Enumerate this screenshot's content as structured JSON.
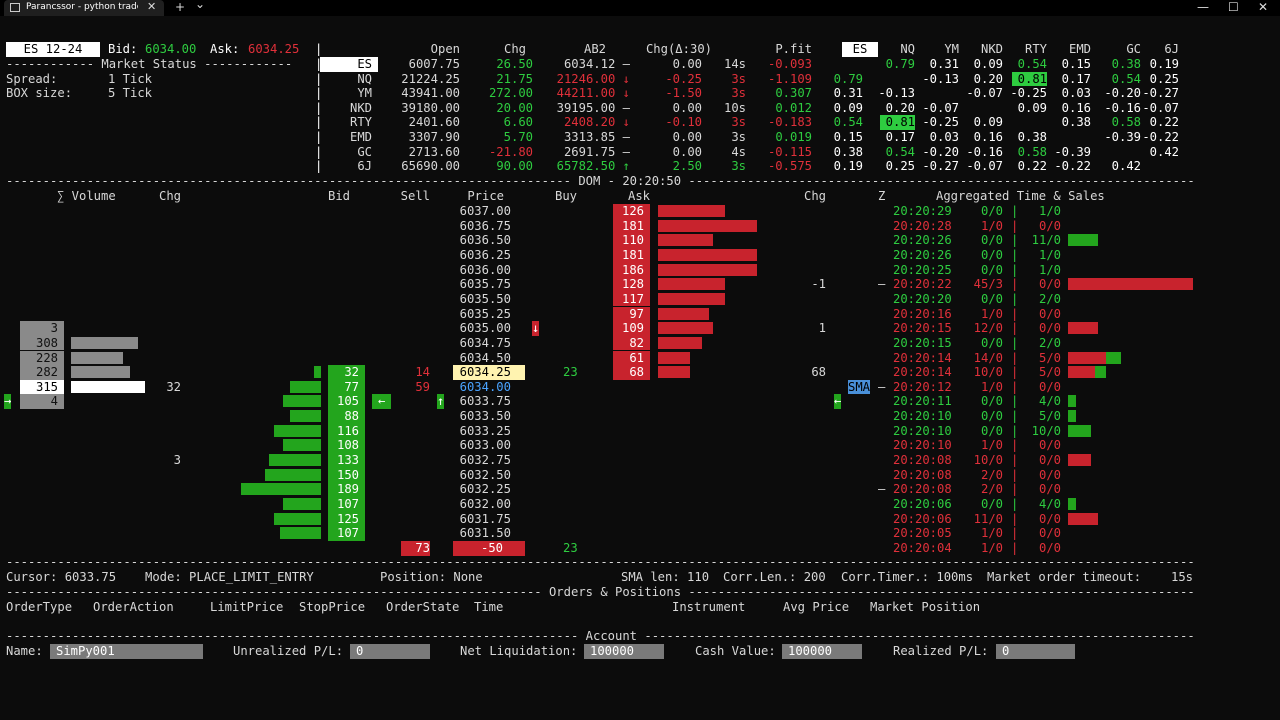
{
  "window": {
    "title": "Parancssor - python  trader.py",
    "close": "✕",
    "new_tab": "+",
    "dropdown": "⌄",
    "minimize": "—",
    "maximize": "☐",
    "close_window": "✕"
  },
  "header": {
    "symbol": "ES 12-24",
    "bid_label": "Bid:",
    "bid": "6034.00",
    "ask_label": "Ask:",
    "ask": "6034.25",
    "market_status": "------------ Market Status ------------",
    "spread_label": "Spread:",
    "spread": "1 Tick",
    "box_label": "BOX size:",
    "box": "5 Tick"
  },
  "quotes": {
    "cols": [
      "Open",
      "Chg",
      "AB2",
      "Chg(Δ:30)",
      "P.fit"
    ],
    "rows": [
      {
        "sym": "ES",
        "open": "6007.75",
        "chg": "26.50",
        "chgc": "g",
        "ab2": "6034.12 –",
        "ab2c": "",
        "d": "0.00",
        "t": "14s",
        "dc": "",
        "pfit": "-0.093",
        "pc": "rd"
      },
      {
        "sym": "NQ",
        "open": "21224.25",
        "chg": "21.75",
        "chgc": "g",
        "ab2": "21246.00 ↓",
        "ab2c": "rd",
        "d": "-0.25",
        "t": "3s",
        "dc": "rd",
        "pfit": "-1.109",
        "pc": "rd"
      },
      {
        "sym": "YM",
        "open": "43941.00",
        "chg": "272.00",
        "chgc": "g",
        "ab2": "44211.00 ↓",
        "ab2c": "rd",
        "d": "-1.50",
        "t": "3s",
        "dc": "rd",
        "pfit": "0.307",
        "pc": "g"
      },
      {
        "sym": "NKD",
        "open": "39180.00",
        "chg": "20.00",
        "chgc": "g",
        "ab2": "39195.00 –",
        "ab2c": "",
        "d": "0.00",
        "t": "10s",
        "dc": "",
        "pfit": "0.012",
        "pc": "g"
      },
      {
        "sym": "RTY",
        "open": "2401.60",
        "chg": "6.60",
        "chgc": "g",
        "ab2": "2408.20 ↓",
        "ab2c": "rd",
        "d": "-0.10",
        "t": "3s",
        "dc": "rd",
        "pfit": "-0.183",
        "pc": "rd"
      },
      {
        "sym": "EMD",
        "open": "3307.90",
        "chg": "5.70",
        "chgc": "g",
        "ab2": "3313.85 –",
        "ab2c": "",
        "d": "0.00",
        "t": "3s",
        "dc": "",
        "pfit": "0.019",
        "pc": "g"
      },
      {
        "sym": "GC",
        "open": "2713.60",
        "chg": "-21.80",
        "chgc": "rd",
        "ab2": "2691.75 –",
        "ab2c": "",
        "d": "0.00",
        "t": "4s",
        "dc": "",
        "pfit": "-0.115",
        "pc": "rd"
      },
      {
        "sym": "6J",
        "open": "65690.00",
        "chg": "90.00",
        "chgc": "g",
        "ab2": "65782.50 ↑",
        "ab2c": "g",
        "d": "2.50",
        "t": "3s",
        "dc": "g",
        "pfit": "-0.575",
        "pc": "rd"
      }
    ]
  },
  "corr": {
    "cols": [
      "ES",
      "NQ",
      "YM",
      "NKD",
      "RTY",
      "EMD",
      "GC",
      "6J"
    ],
    "rows": [
      [
        "",
        "0.79",
        "0.31",
        "0.09",
        "0.54",
        "0.15",
        "0.38",
        "0.19"
      ],
      [
        "0.79",
        "",
        "-0.13",
        "0.20",
        "0.81",
        "0.17",
        "0.54",
        "0.25"
      ],
      [
        "0.31",
        "-0.13",
        "",
        "-0.07",
        "-0.25",
        "0.03",
        "-0.20",
        "-0.27"
      ],
      [
        "0.09",
        "0.20",
        "-0.07",
        "",
        "0.09",
        "0.16",
        "-0.16",
        "-0.07"
      ],
      [
        "0.54",
        "0.81",
        "-0.25",
        "0.09",
        "",
        "0.38",
        "0.58",
        "0.22"
      ],
      [
        "0.15",
        "0.17",
        "0.03",
        "0.16",
        "0.38",
        "",
        "-0.39",
        "-0.22"
      ],
      [
        "0.38",
        "0.54",
        "-0.20",
        "-0.16",
        "0.58",
        "-0.39",
        "",
        "0.42"
      ],
      [
        "0.19",
        "0.25",
        "-0.27",
        "-0.07",
        "0.22",
        "-0.22",
        "0.42",
        ""
      ]
    ],
    "colors": [
      [
        "",
        "g",
        "w",
        "w",
        "g",
        "w",
        "g",
        "w"
      ],
      [
        "g",
        "",
        "w",
        "w",
        "hl",
        "w",
        "g",
        "w"
      ],
      [
        "w",
        "w",
        "",
        "w",
        "w",
        "w",
        "w",
        "w"
      ],
      [
        "w",
        "w",
        "w",
        "",
        "w",
        "w",
        "w",
        "w"
      ],
      [
        "g",
        "hl",
        "w",
        "w",
        "",
        "w",
        "g",
        "w"
      ],
      [
        "w",
        "w",
        "w",
        "w",
        "w",
        "",
        "w",
        "w"
      ],
      [
        "w",
        "g",
        "w",
        "w",
        "g",
        "w",
        "",
        "w"
      ],
      [
        "w",
        "w",
        "w",
        "w",
        "w",
        "w",
        "w",
        ""
      ]
    ]
  },
  "dom": {
    "separator": "DOM - 20:20:50",
    "headers": {
      "volume": "∑ Volume",
      "chg1": "Chg",
      "bid": "Bid",
      "sell": "Sell",
      "price": "Price",
      "buy": "Buy",
      "ask": "Ask",
      "chg2": "Chg",
      "z": "Z",
      "ts": "Aggregated Time & Sales"
    },
    "prices": [
      "6037.00",
      "6036.75",
      "6036.50",
      "6036.25",
      "6036.00",
      "6035.75",
      "6035.50",
      "6035.25",
      "6035.00",
      "6034.75",
      "6034.50",
      "6034.25",
      "6034.00",
      "6033.75",
      "6033.50",
      "6033.25",
      "6033.00",
      "6032.75",
      "6032.50",
      "6032.25",
      "6032.00",
      "6031.75",
      "6031.50",
      "-50"
    ],
    "asks": [
      "126",
      "181",
      "110",
      "181",
      "186",
      "128",
      "117",
      "97",
      "109",
      "82",
      "61",
      "68"
    ],
    "ask_depth": [
      0.29,
      0.43,
      0.24,
      0.43,
      0.43,
      0.29,
      0.29,
      0.22,
      0.24,
      0.19,
      0.14,
      0.14
    ],
    "bids": [
      "32",
      "77",
      "105",
      "88",
      "116",
      "108",
      "133",
      "150",
      "189",
      "107",
      "125",
      "107"
    ],
    "bid_depth": [
      0.06,
      0.26,
      0.32,
      0.26,
      0.39,
      0.32,
      0.43,
      0.47,
      0.67,
      0.32,
      0.39,
      0.34
    ],
    "volumes": [
      "3",
      "308",
      "228",
      "282",
      "315",
      "4"
    ],
    "vol_bar": [
      0,
      0.9,
      0.7,
      0.8,
      1.0,
      0
    ],
    "chg_left": [
      "32",
      "3"
    ],
    "sell": [
      "14",
      "59",
      "73"
    ],
    "buy": [
      "23",
      "23"
    ],
    "chg_right": [
      "-1",
      "1",
      "68"
    ],
    "sma": "SMA",
    "arrows": {
      "right": "→",
      "left": "←",
      "up": "↑",
      "down": "↓",
      "dash": "–"
    },
    "ts": [
      {
        "t": "20:20:29",
        "a": "0/0",
        "b": "1/0",
        "c": "g",
        "bar": 0,
        "bc": ""
      },
      {
        "t": "20:20:28",
        "a": "1/0",
        "b": "0/0",
        "c": "rd",
        "bar": 0,
        "bc": ""
      },
      {
        "t": "20:20:26",
        "a": "0/0",
        "b": "11/0",
        "c": "g",
        "bar": 0.24,
        "bc": "g"
      },
      {
        "t": "20:20:26",
        "a": "0/0",
        "b": "1/0",
        "c": "g",
        "bar": 0,
        "bc": ""
      },
      {
        "t": "20:20:25",
        "a": "0/0",
        "b": "1/0",
        "c": "g",
        "bar": 0,
        "bc": ""
      },
      {
        "t": "20:20:22",
        "a": "45/3",
        "b": "0/0",
        "c": "rd",
        "bar": 1,
        "bc": "rd"
      },
      {
        "t": "20:20:20",
        "a": "0/0",
        "b": "2/0",
        "c": "g",
        "bar": 0,
        "bc": ""
      },
      {
        "t": "20:20:16",
        "a": "1/0",
        "b": "0/0",
        "c": "rd",
        "bar": 0,
        "bc": ""
      },
      {
        "t": "20:20:15",
        "a": "12/0",
        "b": "0/0",
        "c": "rd",
        "bar": 0.24,
        "bc": "rd"
      },
      {
        "t": "20:20:15",
        "a": "0/0",
        "b": "2/0",
        "c": "g",
        "bar": 0,
        "bc": ""
      },
      {
        "t": "20:20:14",
        "a": "14/0",
        "b": "5/0",
        "c": "rd",
        "bar": 0.42,
        "bc": "mix"
      },
      {
        "t": "20:20:14",
        "a": "10/0",
        "b": "5/0",
        "c": "rd",
        "bar": 0.3,
        "bc": "mix"
      },
      {
        "t": "20:20:12",
        "a": "1/0",
        "b": "0/0",
        "c": "rd",
        "bar": 0,
        "bc": ""
      },
      {
        "t": "20:20:11",
        "a": "0/0",
        "b": "4/0",
        "c": "g",
        "bar": 0.06,
        "bc": "g"
      },
      {
        "t": "20:20:10",
        "a": "0/0",
        "b": "5/0",
        "c": "g",
        "bar": 0.06,
        "bc": "g"
      },
      {
        "t": "20:20:10",
        "a": "0/0",
        "b": "10/0",
        "c": "g",
        "bar": 0.18,
        "bc": "g"
      },
      {
        "t": "20:20:10",
        "a": "1/0",
        "b": "0/0",
        "c": "rd",
        "bar": 0,
        "bc": ""
      },
      {
        "t": "20:20:08",
        "a": "10/0",
        "b": "0/0",
        "c": "rd",
        "bar": 0.18,
        "bc": "rd"
      },
      {
        "t": "20:20:08",
        "a": "2/0",
        "b": "0/0",
        "c": "rd",
        "bar": 0,
        "bc": ""
      },
      {
        "t": "20:20:08",
        "a": "2/0",
        "b": "0/0",
        "c": "rd",
        "bar": 0,
        "bc": ""
      },
      {
        "t": "20:20:06",
        "a": "0/0",
        "b": "4/0",
        "c": "g",
        "bar": 0.06,
        "bc": "g"
      },
      {
        "t": "20:20:06",
        "a": "11/0",
        "b": "0/0",
        "c": "rd",
        "bar": 0.24,
        "bc": "rd"
      },
      {
        "t": "20:20:05",
        "a": "1/0",
        "b": "0/0",
        "c": "rd",
        "bar": 0,
        "bc": ""
      },
      {
        "t": "20:20:04",
        "a": "1/0",
        "b": "0/0",
        "c": "rd",
        "bar": 0,
        "bc": ""
      }
    ]
  },
  "status": {
    "cursor": "Cursor: 6033.75",
    "mode": "Mode: PLACE_LIMIT_ENTRY",
    "position": "Position: None",
    "sma": "SMA len: 110",
    "corr_len": "Corr.Len.: 200",
    "corr_timer": "Corr.Timer.: 100ms",
    "mot": "Market order timeout:",
    "mot_val": "15s"
  },
  "orders": {
    "title": "Orders & Positions",
    "cols": [
      "OrderType",
      "OrderAction",
      "LimitPrice",
      "StopPrice",
      "OrderState",
      "Time",
      "Instrument",
      "Avg Price",
      "Market Position"
    ]
  },
  "account": {
    "title": "Account",
    "name_label": "Name:",
    "name": "SimPy001",
    "upl_label": "Unrealized P/L:",
    "upl": "0",
    "nl_label": "Net Liquidation:",
    "nl": "100000",
    "cv_label": "Cash Value:",
    "cv": "100000",
    "rpl_label": "Realized P/L:",
    "rpl": "0"
  },
  "colors": {
    "green": "#2ecc40",
    "red": "#e0303a",
    "bg": "#0c0c0c",
    "grey": "#8a8a8a",
    "highlight": "#fff3b0"
  }
}
